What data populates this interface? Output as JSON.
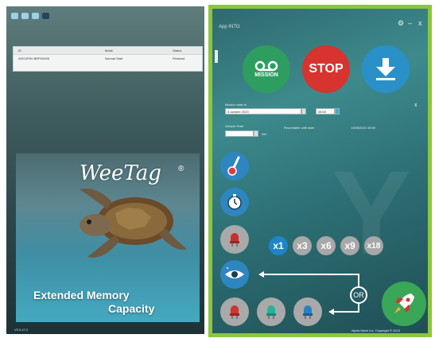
{
  "left_window": {
    "list": {
      "columns": [
        "ID",
        "Mode",
        "Status"
      ],
      "rows": [
        [
          "WG13P00 BRP00495",
          "Normal Start",
          "Finished"
        ]
      ]
    },
    "promo": {
      "brand": "WeeTag",
      "brand_mark": "®",
      "line1": "Extended Memory",
      "line2": "Capacity"
    },
    "version": "V3.0.47.2"
  },
  "right_window": {
    "title": "App INTO",
    "window_buttons": {
      "settings": "⚙",
      "minimize": "–",
      "close": "x"
    },
    "main_buttons": {
      "mission": "MISSION",
      "stop": "STOP"
    },
    "form": {
      "start_label": "Mission start at",
      "date_value": "3 octobre 2020",
      "time_value": "08:00",
      "close_mark": "x",
      "sample_label": "Sample Rate",
      "sample_value": "",
      "sample_unit": "min",
      "note_label": "Recordable until date:",
      "note_value": "13/08/2021 08:00"
    },
    "multipliers": [
      "x1",
      "x3",
      "x6",
      "x9",
      "x18"
    ],
    "active_multiplier": "x1",
    "or_label": "OR",
    "copyright": "Alpha Mach Inc. Copyright © 2013"
  },
  "colors": {
    "accent_frame": "#8cc63f",
    "mission_green": "#2e9e60",
    "stop_red": "#d7332f",
    "download_blue": "#2a90c8",
    "active_blue": "#1f85c7",
    "inactive_gray": "#a8a8a8",
    "rocket_green": "#3aa657"
  }
}
